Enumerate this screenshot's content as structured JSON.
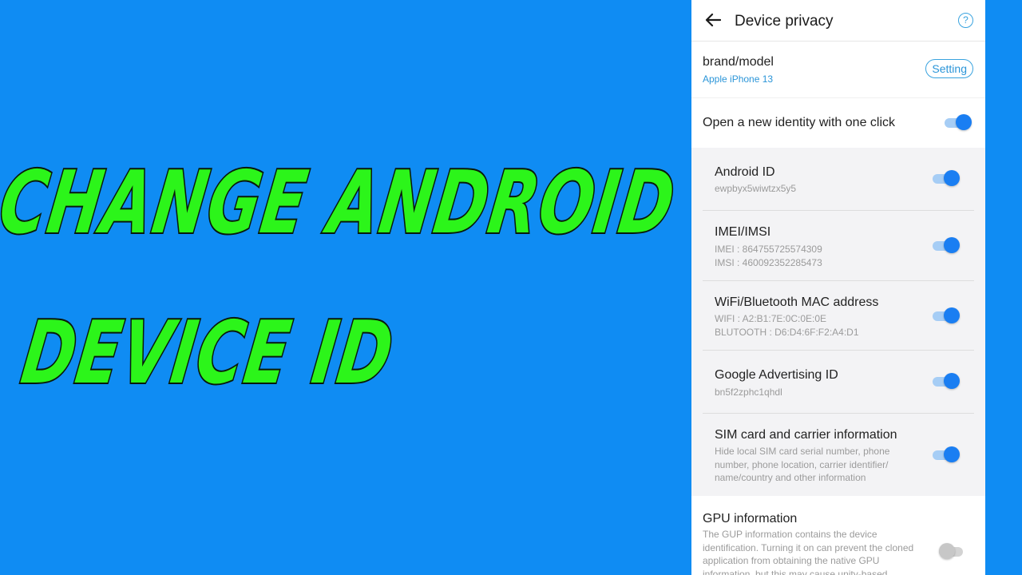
{
  "headline": {
    "line1": "CHANGE ANDROID",
    "line2": "DEVICE ID"
  },
  "topbar": {
    "title": "Device privacy",
    "help_glyph": "?",
    "back_icon": "arrow-left-icon",
    "help_icon": "help-circle-icon"
  },
  "brand": {
    "title": "brand/model",
    "value": "Apple iPhone 13",
    "button_label": "Setting"
  },
  "oneclick": {
    "title": "Open a new identity with one click",
    "enabled": true
  },
  "items": [
    {
      "title": "Android ID",
      "lines": [
        "ewpbyx5wiwtzx5y5"
      ],
      "enabled": true
    },
    {
      "title": "IMEI/IMSI",
      "lines": [
        "IMEI : 864755725574309",
        "IMSI : 460092352285473"
      ],
      "enabled": true
    },
    {
      "title": "WiFi/Bluetooth MAC address",
      "lines": [
        "WIFI : A2:B1:7E:0C:0E:0E",
        "BLUTOOTH : D6:D4:6F:F2:A4:D1"
      ],
      "enabled": true
    },
    {
      "title": "Google Advertising ID",
      "lines": [
        "bn5f2zphc1qhdl"
      ],
      "enabled": true
    },
    {
      "title": "SIM card and carrier information",
      "lines": [
        "Hide local SIM card serial number, phone",
        "number, phone location, carrier identifier/",
        "name/country and other information"
      ],
      "enabled": true
    }
  ],
  "gpu": {
    "title": "GPU information",
    "description": "The GUP information contains the device identification. Turning it on can prevent the cloned application from obtaining the native GPU information, but this may cause unity-based",
    "enabled": false
  },
  "colors": {
    "background": "#0f8cf3",
    "headline": "#2cf51a",
    "accent": "#1a7ef2",
    "link": "#2b95d8"
  }
}
